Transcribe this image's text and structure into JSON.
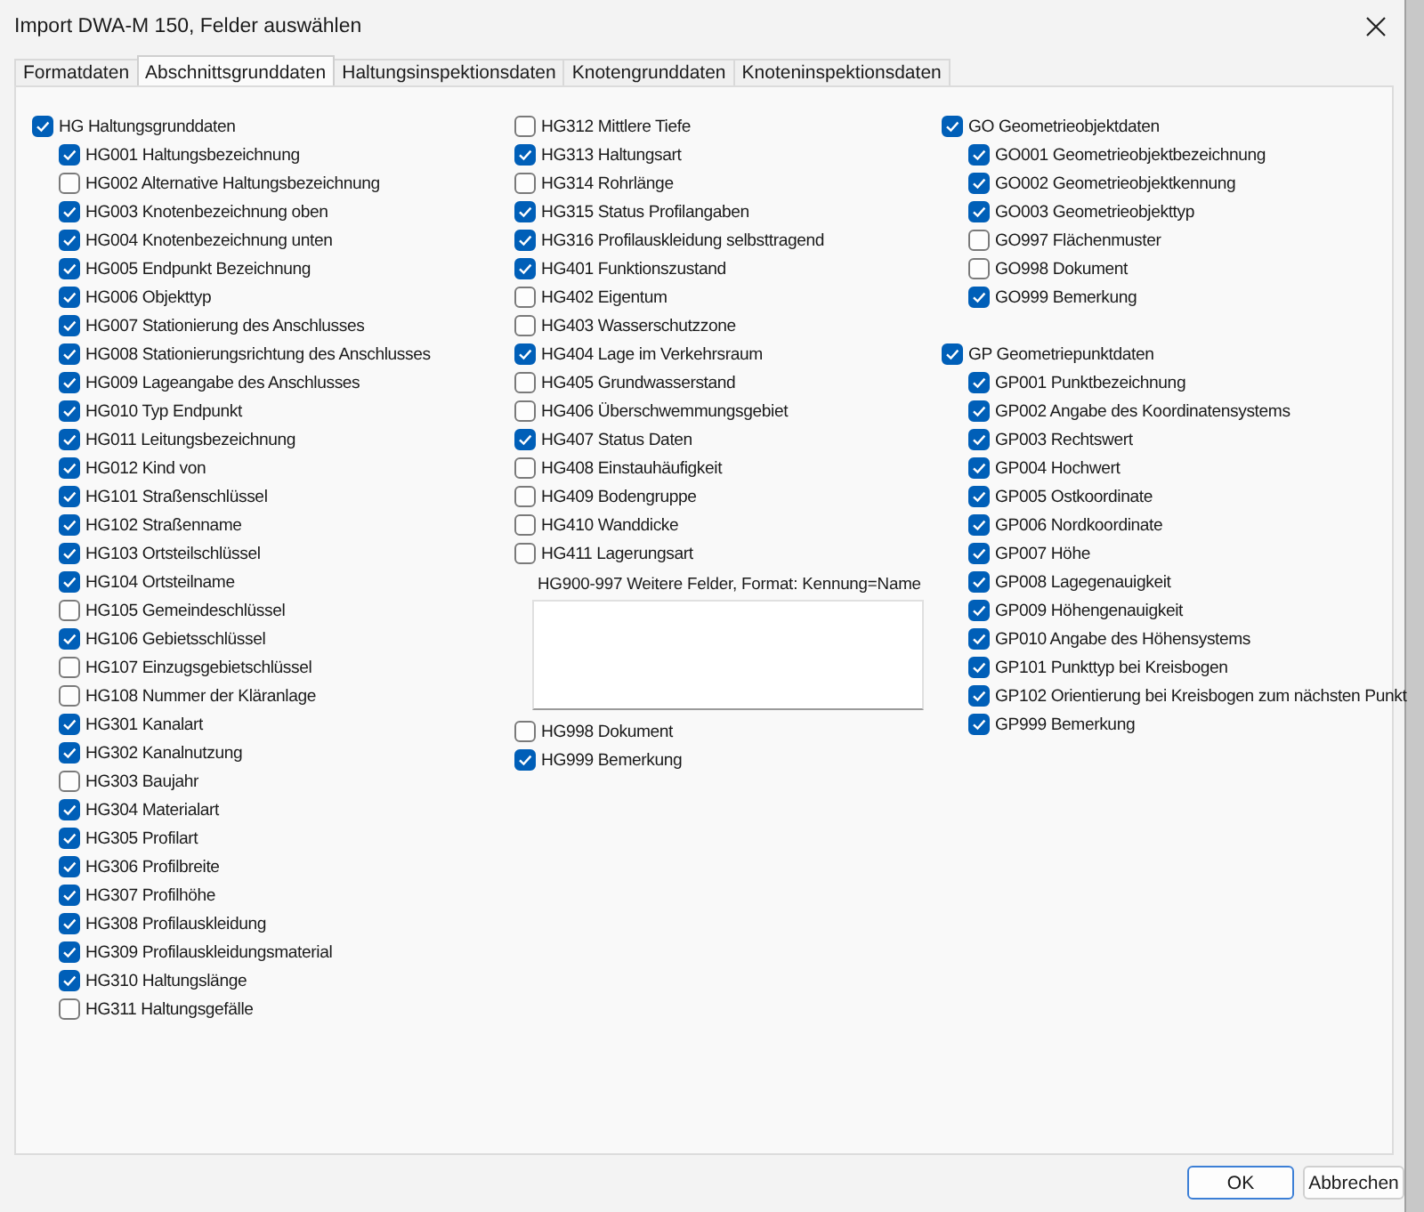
{
  "window": {
    "title": "Import DWA-M 150, Felder auswählen"
  },
  "tabs": [
    {
      "label": "Formatdaten",
      "selected": false
    },
    {
      "label": "Abschnittsgrunddaten",
      "selected": true
    },
    {
      "label": "Haltungsinspektionsdaten",
      "selected": false
    },
    {
      "label": "Knotengrunddaten",
      "selected": false
    },
    {
      "label": "Knoteninspektionsdaten",
      "selected": false
    }
  ],
  "columns": [
    [
      {
        "kind": "group",
        "label": "HG Haltungsgrunddaten",
        "checked": true,
        "children": [
          {
            "label": "HG001 Haltungsbezeichnung",
            "checked": true
          },
          {
            "label": "HG002 Alternative Haltungsbezeichnung",
            "checked": false
          },
          {
            "label": "HG003 Knotenbezeichnung oben",
            "checked": true
          },
          {
            "label": "HG004 Knotenbezeichnung unten",
            "checked": true
          },
          {
            "label": "HG005 Endpunkt Bezeichnung",
            "checked": true
          },
          {
            "label": "HG006 Objekttyp",
            "checked": true
          },
          {
            "label": "HG007 Stationierung des Anschlusses",
            "checked": true
          },
          {
            "label": "HG008 Stationierungsrichtung des Anschlusses",
            "checked": true
          },
          {
            "label": "HG009 Lageangabe des Anschlusses",
            "checked": true
          },
          {
            "label": "HG010 Typ Endpunkt",
            "checked": true
          },
          {
            "label": "HG011 Leitungsbezeichnung",
            "checked": true
          },
          {
            "label": "HG012 Kind von",
            "checked": true
          },
          {
            "label": "HG101 Straßenschlüssel",
            "checked": true
          },
          {
            "label": "HG102 Straßenname",
            "checked": true
          },
          {
            "label": "HG103 Ortsteilschlüssel",
            "checked": true
          },
          {
            "label": "HG104 Ortsteilname",
            "checked": true
          },
          {
            "label": "HG105 Gemeindeschlüssel",
            "checked": false
          },
          {
            "label": "HG106 Gebietsschlüssel",
            "checked": true
          },
          {
            "label": "HG107 Einzugsgebietschlüssel",
            "checked": false
          },
          {
            "label": "HG108 Nummer der Kläranlage",
            "checked": false
          },
          {
            "label": "HG301 Kanalart",
            "checked": true
          },
          {
            "label": "HG302 Kanalnutzung",
            "checked": true
          },
          {
            "label": "HG303 Baujahr",
            "checked": false
          },
          {
            "label": "HG304 Materialart",
            "checked": true
          },
          {
            "label": "HG305 Profilart",
            "checked": true
          },
          {
            "label": "HG306 Profilbreite",
            "checked": true
          },
          {
            "label": "HG307 Profilhöhe",
            "checked": true
          },
          {
            "label": "HG308 Profilauskleidung",
            "checked": true
          },
          {
            "label": "HG309 Profilauskleidungsmaterial",
            "checked": true
          },
          {
            "label": "HG310 Haltungslänge",
            "checked": true
          },
          {
            "label": "HG311 Haltungsgefälle",
            "checked": false
          }
        ]
      }
    ],
    [
      {
        "kind": "check",
        "label": "HG312 Mittlere Tiefe",
        "checked": false
      },
      {
        "kind": "check",
        "label": "HG313 Haltungsart",
        "checked": true
      },
      {
        "kind": "check",
        "label": "HG314 Rohrlänge",
        "checked": false
      },
      {
        "kind": "check",
        "label": "HG315 Status Profilangaben",
        "checked": true
      },
      {
        "kind": "check",
        "label": "HG316 Profilauskleidung selbsttragend",
        "checked": true
      },
      {
        "kind": "check",
        "label": "HG401 Funktionszustand",
        "checked": true
      },
      {
        "kind": "check",
        "label": "HG402 Eigentum",
        "checked": false
      },
      {
        "kind": "check",
        "label": "HG403 Wasserschutzzone",
        "checked": false
      },
      {
        "kind": "check",
        "label": "HG404 Lage im Verkehrsraum",
        "checked": true
      },
      {
        "kind": "check",
        "label": "HG405 Grundwasserstand",
        "checked": false
      },
      {
        "kind": "check",
        "label": "HG406 Überschwemmungsgebiet",
        "checked": false
      },
      {
        "kind": "check",
        "label": "HG407 Status Daten",
        "checked": true
      },
      {
        "kind": "check",
        "label": "HG408 Einstauhäufigkeit",
        "checked": false
      },
      {
        "kind": "check",
        "label": "HG409 Bodengruppe",
        "checked": false
      },
      {
        "kind": "check",
        "label": "HG410 Wanddicke",
        "checked": false
      },
      {
        "kind": "check",
        "label": "HG411 Lagerungsart",
        "checked": false
      },
      {
        "kind": "memo",
        "label": "HG900-997 Weitere Felder, Format: Kennung=Name"
      },
      {
        "kind": "check",
        "label": "HG998 Dokument",
        "checked": false
      },
      {
        "kind": "check",
        "label": "HG999 Bemerkung",
        "checked": true
      }
    ],
    [
      {
        "kind": "group",
        "label": "GO Geometrieobjektdaten",
        "checked": true,
        "children": [
          {
            "label": "GO001 Geometrieobjektbezeichnung",
            "checked": true
          },
          {
            "label": "GO002 Geometrieobjektkennung",
            "checked": true
          },
          {
            "label": "GO003 Geometrieobjekttyp",
            "checked": true
          },
          {
            "label": "GO997 Flächenmuster",
            "checked": false
          },
          {
            "label": "GO998 Dokument",
            "checked": false
          },
          {
            "label": "GO999 Bemerkung",
            "checked": true
          }
        ]
      },
      {
        "kind": "group",
        "label": "GP Geometriepunktdaten",
        "checked": true,
        "children": [
          {
            "label": "GP001 Punktbezeichnung",
            "checked": true
          },
          {
            "label": "GP002 Angabe des Koordinatensystems",
            "checked": true
          },
          {
            "label": "GP003 Rechtswert",
            "checked": true
          },
          {
            "label": "GP004 Hochwert",
            "checked": true
          },
          {
            "label": "GP005 Ostkoordinate",
            "checked": true
          },
          {
            "label": "GP006 Nordkoordinate",
            "checked": true
          },
          {
            "label": "GP007 Höhe",
            "checked": true
          },
          {
            "label": "GP008 Lagegenauigkeit",
            "checked": true
          },
          {
            "label": "GP009 Höhengenauigkeit",
            "checked": true
          },
          {
            "label": "GP010 Angabe des Höhensystems",
            "checked": true
          },
          {
            "label": "GP101 Punkttyp bei Kreisbogen",
            "checked": true
          },
          {
            "label": "GP102 Orientierung bei Kreisbogen zum nächsten Punkt",
            "checked": true
          },
          {
            "label": "GP999 Bemerkung",
            "checked": true
          }
        ]
      }
    ]
  ],
  "buttons": [
    {
      "label": "OK",
      "default": true
    },
    {
      "label": "Abbrechen",
      "default": false
    }
  ]
}
